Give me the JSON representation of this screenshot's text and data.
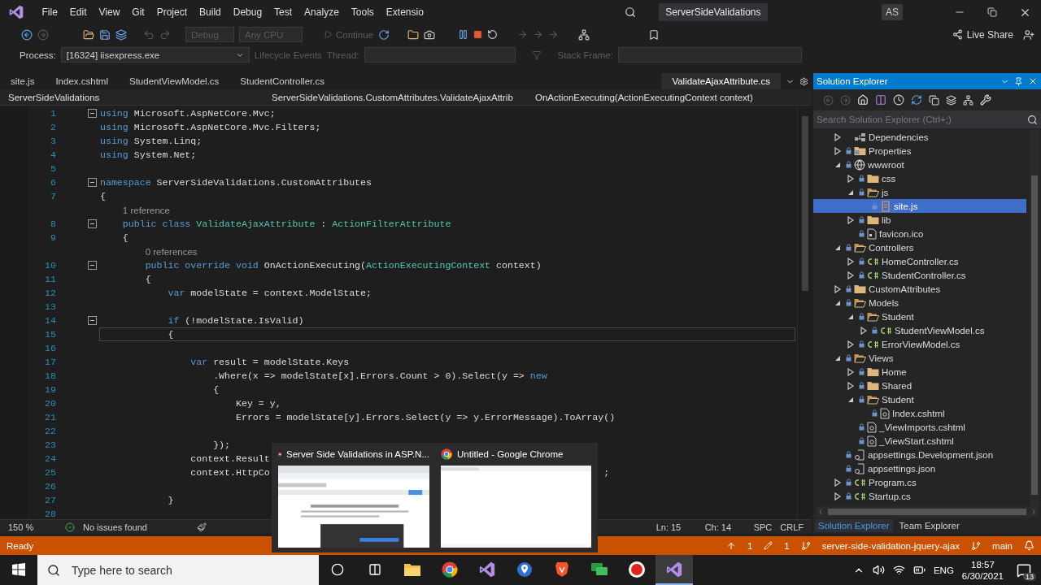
{
  "title_bar": {
    "menu": [
      "File",
      "Edit",
      "View",
      "Git",
      "Project",
      "Build",
      "Debug",
      "Test",
      "Analyze",
      "Tools",
      "Extensio"
    ],
    "solution": "ServerSideValidations",
    "avatar": "AS"
  },
  "toolbar": {
    "config": {
      "value": "Debug",
      "disabled": true
    },
    "platform": {
      "value": "Any CPU",
      "disabled": true
    },
    "continue": {
      "label": "Continue",
      "disabled": true
    },
    "live_share": "Live Share"
  },
  "debug_bar": {
    "process_label": "Process:",
    "process": "[16324] iisexpress.exe",
    "lifecycle": {
      "label": "Lifecycle Events",
      "disabled": true
    },
    "thread": {
      "label": "Thread:",
      "disabled": true
    },
    "stack_frame": {
      "label": "Stack Frame:",
      "disabled": true
    }
  },
  "tabs": [
    {
      "label": "site.js",
      "selected": false,
      "preview": false
    },
    {
      "label": "Index.cshtml",
      "selected": false,
      "preview": false
    },
    {
      "label": "StudentViewModel.cs",
      "selected": false,
      "preview": false
    },
    {
      "label": "StudentController.cs",
      "selected": false,
      "preview": false
    },
    {
      "label": "ValidateAjaxAttribute.cs",
      "selected": true,
      "preview": true
    }
  ],
  "nav_bar": {
    "project": "ServerSideValidations",
    "type": "ServerSideValidations.CustomAttributes.ValidateAjaxAttrib",
    "member": "OnActionExecuting(ActionExecutingContext context)"
  },
  "editor": {
    "lines": [
      {
        "kind": "code",
        "number": "1",
        "fold": true,
        "current": false,
        "tokens": [
          {
            "kind": "kw",
            "text": "using"
          },
          {
            "kind": "plain",
            "text": " Microsoft.AspNetCore.Mvc;"
          }
        ]
      },
      {
        "kind": "code",
        "number": "2",
        "fold": false,
        "current": false,
        "tokens": [
          {
            "kind": "kw",
            "text": "using"
          },
          {
            "kind": "plain",
            "text": " Microsoft.AspNetCore.Mvc.Filters;"
          }
        ]
      },
      {
        "kind": "code",
        "number": "3",
        "fold": false,
        "current": false,
        "tokens": [
          {
            "kind": "kw",
            "text": "using"
          },
          {
            "kind": "plain",
            "text": " System.Linq;"
          }
        ]
      },
      {
        "kind": "code",
        "number": "4",
        "fold": false,
        "current": false,
        "tokens": [
          {
            "kind": "kw",
            "text": "using"
          },
          {
            "kind": "plain",
            "text": " System.Net;"
          }
        ]
      },
      {
        "kind": "code",
        "number": "5",
        "fold": false,
        "current": false
      },
      {
        "kind": "code",
        "number": "6",
        "fold": true,
        "current": false,
        "tokens": [
          {
            "kind": "kw",
            "text": "namespace"
          },
          {
            "kind": "plain",
            "text": " ServerSideValidations.CustomAttributes"
          }
        ]
      },
      {
        "kind": "code",
        "number": "7",
        "fold": false,
        "current": false,
        "tokens": [
          {
            "kind": "plain",
            "text": "{"
          }
        ]
      },
      {
        "kind": "lens",
        "text": "1 reference"
      },
      {
        "kind": "code",
        "number": "8",
        "fold": true,
        "current": false,
        "tokens": [
          {
            "kind": "kw",
            "text": "    public class"
          },
          {
            "kind": "type",
            "text": " ValidateAjaxAttribute"
          },
          {
            "kind": "plain",
            "text": " : "
          },
          {
            "kind": "type",
            "text": "ActionFilterAttribute"
          }
        ]
      },
      {
        "kind": "code",
        "number": "9",
        "fold": false,
        "current": false,
        "tokens": [
          {
            "kind": "plain",
            "text": "    {"
          }
        ]
      },
      {
        "kind": "lens",
        "text": "0 references"
      },
      {
        "kind": "code",
        "number": "10",
        "fold": true,
        "current": false,
        "tokens": [
          {
            "kind": "kw",
            "text": "        public override void"
          },
          {
            "kind": "plain",
            "text": " OnActionExecuting("
          },
          {
            "kind": "type",
            "text": "ActionExecutingContext"
          },
          {
            "kind": "plain",
            "text": " context)"
          }
        ]
      },
      {
        "kind": "code",
        "number": "11",
        "fold": false,
        "current": false,
        "tokens": [
          {
            "kind": "plain",
            "text": "        {"
          }
        ]
      },
      {
        "kind": "code",
        "number": "12",
        "fold": false,
        "current": false,
        "tokens": [
          {
            "kind": "kw",
            "text": "            var"
          },
          {
            "kind": "plain",
            "text": " modelState = context.ModelState;"
          }
        ]
      },
      {
        "kind": "code",
        "number": "13",
        "fold": false,
        "current": false
      },
      {
        "kind": "code",
        "number": "14",
        "fold": true,
        "current": false,
        "tokens": [
          {
            "kind": "kw",
            "text": "            if"
          },
          {
            "kind": "plain",
            "text": " (!modelState.IsValid)"
          }
        ]
      },
      {
        "kind": "code",
        "number": "15",
        "fold": false,
        "current": true,
        "tokens": [
          {
            "kind": "plain",
            "text": "            {"
          }
        ]
      },
      {
        "kind": "code",
        "number": "16",
        "fold": false,
        "current": false
      },
      {
        "kind": "code",
        "number": "17",
        "fold": false,
        "current": false,
        "tokens": [
          {
            "kind": "kw",
            "text": "                var"
          },
          {
            "kind": "plain",
            "text": " result = modelState.Keys"
          }
        ]
      },
      {
        "kind": "code",
        "number": "18",
        "fold": false,
        "current": false,
        "tokens": [
          {
            "kind": "plain",
            "text": "                    .Where(x => modelState[x].Errors.Count > 0).Select(y => "
          },
          {
            "kind": "kw",
            "text": "new"
          }
        ]
      },
      {
        "kind": "code",
        "number": "19",
        "fold": false,
        "current": false,
        "tokens": [
          {
            "kind": "plain",
            "text": "                    {"
          }
        ]
      },
      {
        "kind": "code",
        "number": "20",
        "fold": false,
        "current": false,
        "tokens": [
          {
            "kind": "plain",
            "text": "                        Key = y,"
          }
        ]
      },
      {
        "kind": "code",
        "number": "21",
        "fold": false,
        "current": false,
        "tokens": [
          {
            "kind": "plain",
            "text": "                        Errors = modelState[y].Errors.Select(y => y.ErrorMessage).ToArray()"
          }
        ]
      },
      {
        "kind": "code",
        "number": "22",
        "fold": false,
        "current": false
      },
      {
        "kind": "code",
        "number": "23",
        "fold": false,
        "current": false,
        "tokens": [
          {
            "kind": "plain",
            "text": "                    });"
          }
        ]
      },
      {
        "kind": "code",
        "number": "24",
        "fold": false,
        "current": false,
        "tokens": [
          {
            "kind": "plain",
            "text": "                context.Result"
          }
        ]
      },
      {
        "kind": "code",
        "number": "25",
        "fold": false,
        "current": false,
        "tokens": [
          {
            "kind": "plain",
            "text": "                context.HttpCo"
          },
          {
            "kind": "tail",
            "text": ";"
          }
        ]
      },
      {
        "kind": "code",
        "number": "26",
        "fold": false,
        "current": false
      },
      {
        "kind": "code",
        "number": "27",
        "fold": false,
        "current": false,
        "tokens": [
          {
            "kind": "plain",
            "text": "            }"
          }
        ]
      },
      {
        "kind": "code",
        "number": "28",
        "fold": false,
        "current": false
      }
    ]
  },
  "editor_status": {
    "zoom": "150 %",
    "issues": "No issues found",
    "line": "Ln: 15",
    "column": "Ch: 14",
    "whitespace": "SPC",
    "line_endings": "CRLF"
  },
  "solution_explorer": {
    "title": "Solution Explorer",
    "search": {
      "placeholder": "Search Solution Explorer (Ctrl+;)"
    },
    "tree": [
      {
        "label": "Dependencies",
        "kind": "deps",
        "locked": false,
        "expanded": false,
        "selected": false
      },
      {
        "label": "Properties",
        "kind": "props",
        "locked": true,
        "expanded": false,
        "selected": false
      },
      {
        "label": "wwwroot",
        "kind": "globe",
        "locked": true,
        "expanded": true,
        "selected": false,
        "children": [
          {
            "label": "css",
            "kind": "folder",
            "locked": true,
            "expanded": false,
            "selected": false
          },
          {
            "label": "js",
            "kind": "folder",
            "locked": true,
            "expanded": true,
            "selected": false,
            "children": [
              {
                "label": "site.js",
                "kind": "js",
                "locked": true,
                "selected": true
              }
            ]
          },
          {
            "label": "lib",
            "kind": "folder",
            "locked": true,
            "expanded": false,
            "selected": false
          },
          {
            "label": "favicon.ico",
            "kind": "file",
            "locked": true,
            "selected": false
          }
        ]
      },
      {
        "label": "Controllers",
        "kind": "folder",
        "locked": true,
        "expanded": true,
        "selected": false,
        "children": [
          {
            "label": "HomeController.cs",
            "kind": "cs",
            "locked": true,
            "expanded": false,
            "selected": false
          },
          {
            "label": "StudentController.cs",
            "kind": "cs",
            "locked": true,
            "expanded": false,
            "selected": false
          }
        ]
      },
      {
        "label": "CustomAttributes",
        "kind": "folder",
        "locked": true,
        "expanded": false,
        "selected": false
      },
      {
        "label": "Models",
        "kind": "folder",
        "locked": true,
        "expanded": true,
        "selected": false,
        "children": [
          {
            "label": "Student",
            "kind": "folder",
            "locked": true,
            "expanded": true,
            "selected": false,
            "children": [
              {
                "label": "StudentViewModel.cs",
                "kind": "cs",
                "locked": true,
                "expanded": false,
                "selected": false
              }
            ]
          },
          {
            "label": "ErrorViewModel.cs",
            "kind": "cs",
            "locked": true,
            "expanded": false,
            "selected": false
          }
        ]
      },
      {
        "label": "Views",
        "kind": "folder",
        "locked": true,
        "expanded": true,
        "selected": false,
        "children": [
          {
            "label": "Home",
            "kind": "folder",
            "locked": true,
            "expanded": false,
            "selected": false
          },
          {
            "label": "Shared",
            "kind": "folder",
            "locked": true,
            "expanded": false,
            "selected": false
          },
          {
            "label": "Student",
            "kind": "folder",
            "locked": true,
            "expanded": true,
            "selected": false,
            "children": [
              {
                "label": "Index.cshtml",
                "kind": "razor",
                "locked": true,
                "selected": false
              }
            ]
          },
          {
            "label": "_ViewImports.cshtml",
            "kind": "razor",
            "locked": true,
            "selected": false
          },
          {
            "label": "_ViewStart.cshtml",
            "kind": "razor",
            "locked": true,
            "selected": false
          }
        ]
      },
      {
        "label": "appsettings.Development.json",
        "kind": "json",
        "locked": true,
        "selected": false
      },
      {
        "label": "appsettings.json",
        "kind": "json",
        "locked": true,
        "selected": false
      },
      {
        "label": "Program.cs",
        "kind": "cs",
        "locked": true,
        "expanded": false,
        "selected": false
      },
      {
        "label": "Startup.cs",
        "kind": "cs",
        "locked": true,
        "expanded": false,
        "selected": false
      }
    ],
    "footer_tabs": [
      {
        "label": "Solution Explorer",
        "selected": true
      },
      {
        "label": "Team Explorer",
        "selected": false
      }
    ]
  },
  "status_bar": {
    "state": "Ready",
    "push": "1",
    "changes": "1",
    "repository": "server-side-validation-jquery-ajax",
    "branch": "main"
  },
  "taskbar": {
    "search": {
      "placeholder": "Type here to search"
    },
    "apps": [
      {
        "kind": "folder",
        "active": false
      },
      {
        "kind": "chrome",
        "active": false
      },
      {
        "kind": "vs",
        "active": false
      },
      {
        "kind": "pin",
        "active": false
      },
      {
        "kind": "lion",
        "active": false
      },
      {
        "kind": "chat",
        "active": false
      },
      {
        "kind": "record",
        "active": false
      },
      {
        "kind": "vs",
        "active": true
      }
    ],
    "language": "ENG",
    "time": "18:57",
    "date": "6/30/2021",
    "notifications": "13"
  },
  "taskbar_preview": [
    {
      "title": "Server Side Validations in ASP.N...",
      "kind": "picture"
    },
    {
      "title": "Untitled - Google Chrome",
      "kind": "picture"
    }
  ]
}
